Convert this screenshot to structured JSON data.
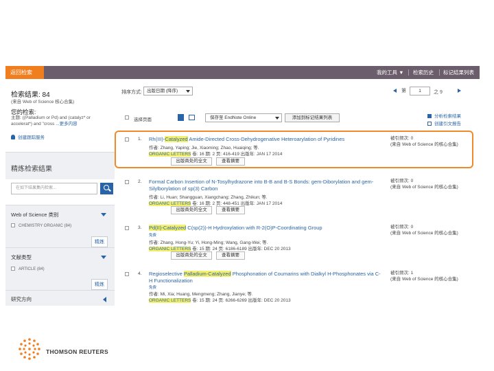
{
  "topbar": {
    "back_label": "返回检索",
    "tools": [
      "我的工具 ▼",
      "检索历史",
      "标记结果列表"
    ]
  },
  "sidebar": {
    "result_count": "检索结果: 84",
    "result_source": "(来自 Web of Science 核心合集)",
    "query_label": "您的检索:",
    "query_text": "主题: ((Palladium or Pd) and (catalyz* or accelerat*) and \"cross",
    "query_more": "...更多内容",
    "alert_label": "创建跟踪服务",
    "refine_title": "精炼检索结果",
    "refine_placeholder": "在如下结果集内检索...",
    "facets": [
      {
        "header": "Web of Science 类别",
        "item": "CHEMISTRY ORGANIC (84)",
        "button": "精炼"
      },
      {
        "header": "文献类型",
        "item": "ARTICLE (84)",
        "button": "精炼"
      },
      {
        "header": "研究方向"
      }
    ]
  },
  "main": {
    "sort_label": "排序方式:",
    "sort_value": "出版日期 (降序)",
    "page_current": "1",
    "page_total": "之 9",
    "select_page": "选择页面",
    "save_option": "保存至 EndNote Online",
    "add_marked": "添加到标记结果列表",
    "analyze": "分析检索结果",
    "citation_report": "创建引文报告",
    "records": [
      {
        "num": "1.",
        "title_pre": "Rh(III)-",
        "title_hl": "Catalyzed",
        "title_post": " Amide-Directed Cross-Dehydrogenative Heteroarylation of Pyridines",
        "authors": "作者: Zhang, Yaping; Jie, Xiaoming; Zhao, Huaiqing; 等.",
        "journal": "ORGANIC LETTERS",
        "src": " 卷: 16   期: 2   页: 416-419   出版年: JAN 17 2014",
        "free": "",
        "buttons": [
          "出版商处的全文",
          "查看摘要"
        ],
        "cites": "被引频次: 0",
        "cites_src": "(来自 Web of Science 的核心合集)"
      },
      {
        "num": "2.",
        "title_pre": "Formal Carbon Insertion of N-Tosylhydrazone into B-B and B-S Bonds: gem-Diborylation and gem-Silylborylation of sp(3) Carbon",
        "title_hl": "",
        "title_post": "",
        "authors": "作者: Li, Huan; Shangguan, Xiangchang; Zhang, Zhikun; 等.",
        "journal": "ORGANIC LETTERS",
        "src": " 卷: 16   期: 2   页: 448-451   出版年: JAN 17 2014",
        "free": "",
        "buttons": [
          "出版商处的全文",
          "查看摘要"
        ],
        "cites": "被引频次: 0",
        "cites_src": "(来自 Web of Science 的核心合集)"
      },
      {
        "num": "3.",
        "title_pre": "",
        "title_hl": "Pd(II)-Catalyzed",
        "title_post": " C(sp(2))-H Hydroxylation with R-2(O)P-Coordinating Group",
        "authors": "作者: Zhang, Hong-Yu; Yi, Hong-Ming; Wang, Gang-Wei; 等.",
        "journal": "ORGANIC LETTERS",
        "src": " 卷: 15   期: 24   页: 6186-6189   出版年: DEC 20 2013",
        "free": "免费",
        "buttons": [
          "出版商处的全文",
          "查看摘要"
        ],
        "cites": "被引频次: 0",
        "cites_src": "(来自 Web of Science 的核心合集)"
      },
      {
        "num": "4.",
        "title_pre": "Regioselective ",
        "title_hl": "Palladium-Catalyzed",
        "title_post": " Phosphonation of Coumarins with Dialkyl H-Phosphonates via C-H Functionalization",
        "authors": "作者: Mi, Xia; Huang, Mengmeng; Zhang, Jianye; 等.",
        "journal": "ORGANIC LETTERS",
        "src": " 卷: 15   期: 24   页: 6266-6269   出版年: DEC 20 2013",
        "free": "免费",
        "buttons": [],
        "cites": "被引频次: 1",
        "cites_src": "(来自 Web of Science 的核心合集)"
      }
    ]
  },
  "footer": {
    "brand": "THOMSON REUTERS"
  },
  "colors": {
    "topbar": "#6b5d6b",
    "accent_orange": "#f07d1e",
    "link_blue": "#2a64a8",
    "highlight": "#f5f06b"
  }
}
